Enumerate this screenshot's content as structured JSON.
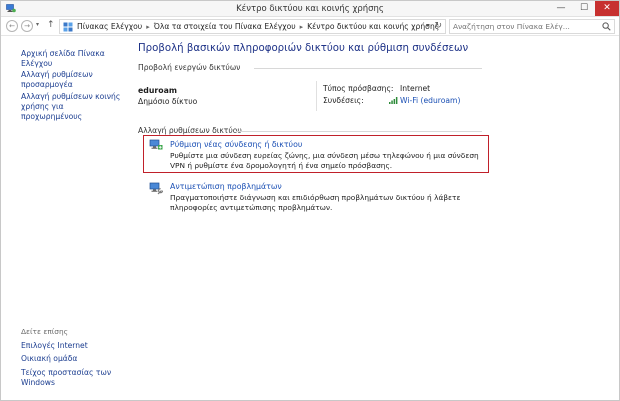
{
  "window": {
    "title": "Κέντρο δικτύου και κοινής χρήσης",
    "minimize_glyph": "—",
    "maximize_glyph": "☐",
    "close_glyph": "✕"
  },
  "address": {
    "back_glyph": "←",
    "forward_glyph": "→",
    "recent_glyph": "▾",
    "up_glyph": "↑",
    "crumbs": [
      "Πίνακας Ελέγχου",
      "Όλα τα στοιχεία του Πίνακα Ελέγχου",
      "Κέντρο δικτύου και κοινής χρήσης"
    ],
    "separator_glyph": "▸",
    "dropdown_glyph": "▾",
    "refresh_glyph": "↻",
    "search_placeholder": "Αναζήτηση στον Πίνακα Ελέγ..."
  },
  "sidebar": {
    "home_link": "Αρχική σελίδα Πίνακα Ελέγχου",
    "links": [
      "Αλλαγή ρυθμίσεων προσαρμογέα",
      "Αλλαγή ρυθμίσεων κοινής χρήσης για προχωρημένους"
    ],
    "see_also_heading": "Δείτε επίσης",
    "see_also": [
      "Επιλογές Internet",
      "Οικιακή ομάδα",
      "Τείχος προστασίας των Windows"
    ]
  },
  "main": {
    "title": "Προβολή βασικών πληροφοριών δικτύου και ρύθμιση συνδέσεων",
    "active_networks_label": "Προβολή ενεργών δικτύων",
    "network": {
      "name": "eduroam",
      "category": "Δημόσιο δίκτυο",
      "access_type_label": "Τύπος πρόσβασης:",
      "access_type_value": "Internet",
      "connections_label": "Συνδέσεις:",
      "connections_value": "Wi-Fi (eduroam)"
    },
    "change_settings_label": "Αλλαγή ρυθμίσεων δικτύου",
    "tasks": [
      {
        "link": "Ρύθμιση νέας σύνδεσης ή δικτύου",
        "description": "Ρυθμίστε μια σύνδεση ευρείας ζώνης, μια σύνδεση μέσω τηλεφώνου ή μια σύνδεση VPN ή ρυθμίστε ένα δρομολογητή ή ένα σημείο πρόσβασης."
      },
      {
        "link": "Αντιμετώπιση προβλημάτων",
        "description": "Πραγματοποιήστε διάγνωση και επιδιόρθωση προβλημάτων δικτύου ή λάβετε πληροφορίες αντιμετώπισης προβλημάτων."
      }
    ]
  },
  "colors": {
    "link": "#1a4fb4",
    "title": "#1e3287",
    "highlight": "#c0202a",
    "close_button": "#c7302f"
  }
}
